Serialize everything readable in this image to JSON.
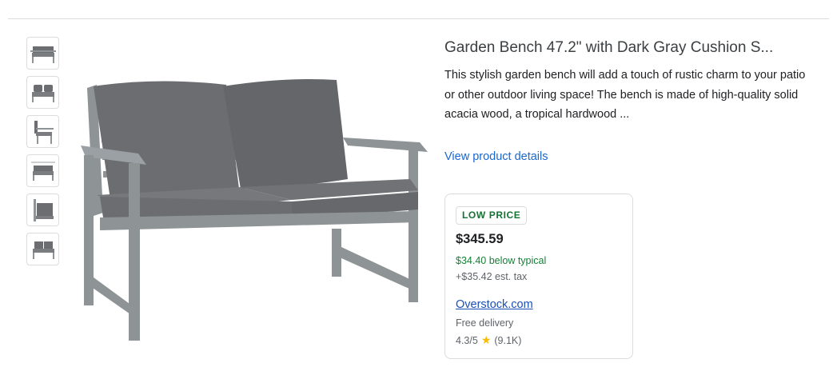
{
  "product": {
    "title": "Garden Bench 47.2\" with Dark Gray Cushion S...",
    "description": "This stylish garden bench will add a touch of rustic charm to your patio or other outdoor living space! The bench is made of high-quality solid acacia wood, a tropical hardwood ...",
    "view_details_label": "View product details"
  },
  "thumbnails": [
    {
      "icon": "bench-front-thumbnail"
    },
    {
      "icon": "bench-cushions-thumbnail"
    },
    {
      "icon": "bench-side-thumbnail"
    },
    {
      "icon": "bench-dimensions-thumbnail"
    },
    {
      "icon": "bench-back-thumbnail"
    },
    {
      "icon": "bench-angle-thumbnail"
    }
  ],
  "offer": {
    "badge": "LOW PRICE",
    "price": "$345.59",
    "below_typical": "$34.40 below typical",
    "tax": "+$35.42 est. tax",
    "merchant": "Overstock.com",
    "delivery": "Free delivery",
    "rating": "4.3/5",
    "reviews": "(9.1K)",
    "star_icon": "star-icon"
  },
  "colors": {
    "link_blue": "#1967d2",
    "low_price_green": "#137333",
    "below_typical_green": "#188038",
    "star_yellow": "#fbbc04",
    "wood_gray": "#8e9396",
    "cushion_gray": "#6b6d71"
  }
}
